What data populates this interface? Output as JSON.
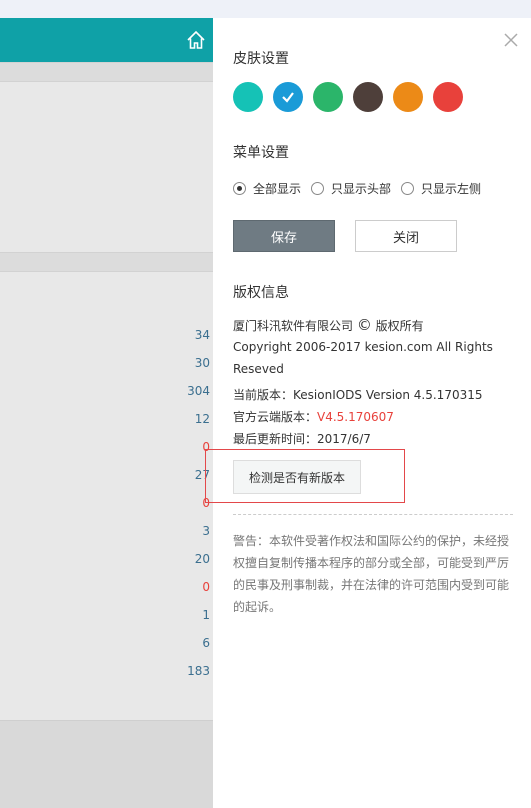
{
  "background": {
    "numbers": [
      {
        "value": "34",
        "red": false
      },
      {
        "value": "30",
        "red": false
      },
      {
        "value": "304",
        "red": false
      },
      {
        "value": "12",
        "red": false
      },
      {
        "value": "0",
        "red": true
      },
      {
        "value": "27",
        "red": false
      },
      {
        "value": "0",
        "red": true
      },
      {
        "value": "3",
        "red": false
      },
      {
        "value": "20",
        "red": false
      },
      {
        "value": "0",
        "red": true
      },
      {
        "value": "1",
        "red": false
      },
      {
        "value": "6",
        "red": false
      },
      {
        "value": "183",
        "red": false
      }
    ]
  },
  "panel": {
    "skin_title": "皮肤设置",
    "skins": [
      {
        "color": "#15c2b6",
        "selected": false
      },
      {
        "color": "#1a9bd7",
        "selected": true
      },
      {
        "color": "#2bb56a",
        "selected": false
      },
      {
        "color": "#4e3f3a",
        "selected": false
      },
      {
        "color": "#ec8a17",
        "selected": false
      },
      {
        "color": "#e8413b",
        "selected": false
      }
    ],
    "menu_title": "菜单设置",
    "menu_options": [
      {
        "label": "全部显示",
        "checked": true
      },
      {
        "label": "只显示头部",
        "checked": false
      },
      {
        "label": "只显示左侧",
        "checked": false
      }
    ],
    "save_label": "保存",
    "close_label": "关闭",
    "copyright_title": "版权信息",
    "company_pre": "厦门科汛软件有限公司",
    "copyright_sign": "©",
    "company_post": "版权所有",
    "copyright_line": "Copyright 2006-2017 kesion.com All Rights Reseved",
    "current_version": "当前版本：KesionIODS Version 4.5.170315",
    "cloud_version_label": "官方云端版本：",
    "cloud_version_value": "V4.5.170607",
    "last_update": "最后更新时间：2017/6/7",
    "check_update_label": "检测是否有新版本",
    "warning_text": "警告：本软件受著作权法和国际公约的保护，未经授权擅自复制传播本程序的部分或全部，可能受到严厉的民事及刑事制裁，并在法律的许可范围内受到可能的起诉。"
  }
}
